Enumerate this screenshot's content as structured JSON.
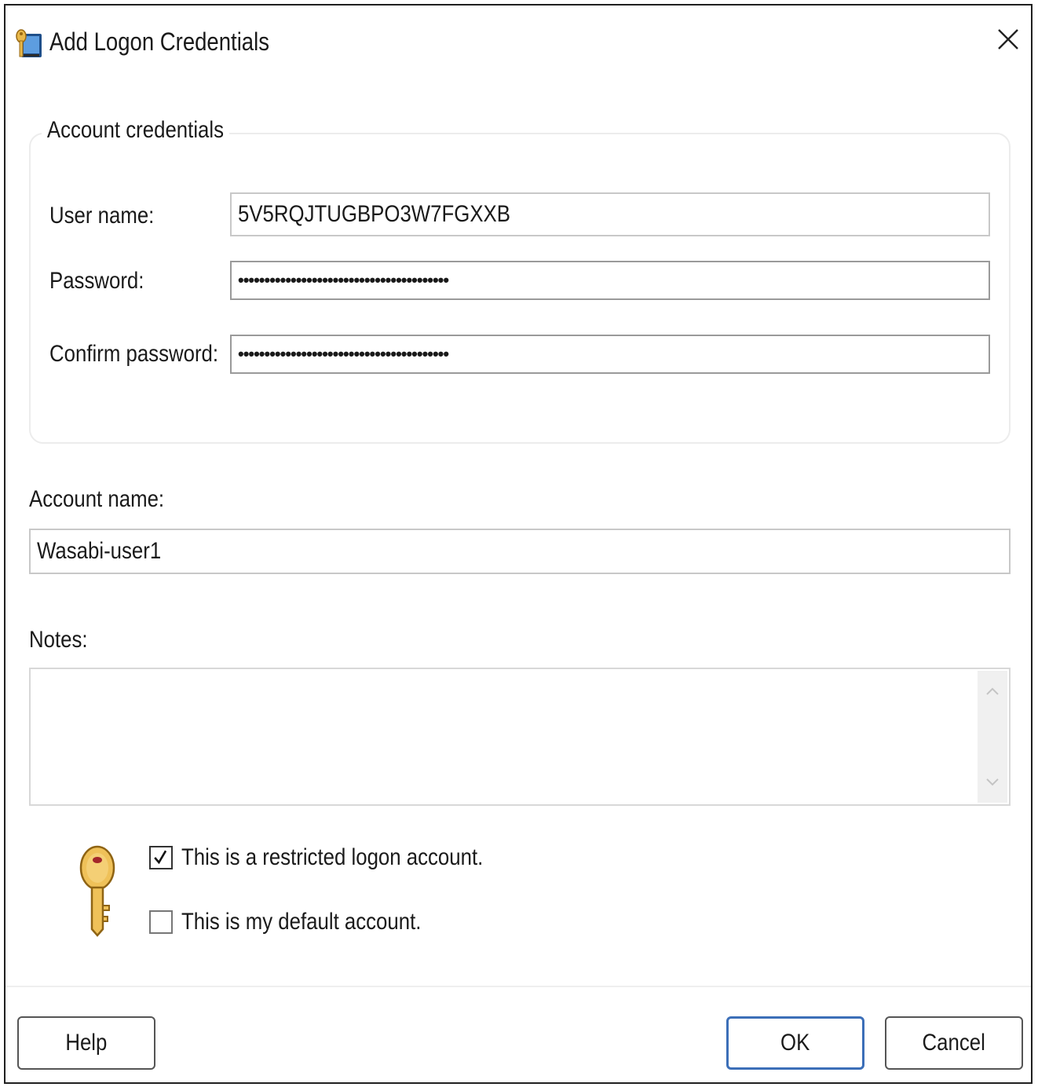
{
  "window": {
    "title": "Add Logon Credentials"
  },
  "credentials_group": {
    "legend": "Account credentials",
    "user_name_label": "User name:",
    "user_name_value": "5V5RQJTUGBPO3W7FGXXB",
    "password_label": "Password:",
    "password_value": "••••••••••••••••••••••••••••••••••••••••",
    "confirm_password_label": "Confirm password:",
    "confirm_password_value": "••••••••••••••••••••••••••••••••••••••••"
  },
  "account": {
    "label": "Account name:",
    "value": "Wasabi-user1"
  },
  "notes": {
    "label": "Notes:",
    "value": ""
  },
  "options": {
    "restricted_label": "This is a restricted logon account.",
    "restricted_checked": true,
    "default_label": "This is my default account.",
    "default_checked": false
  },
  "buttons": {
    "help": "Help",
    "ok": "OK",
    "cancel": "Cancel"
  },
  "colors": {
    "default_button_border": "#3c6fb8",
    "key_icon": "#e8b84a"
  }
}
